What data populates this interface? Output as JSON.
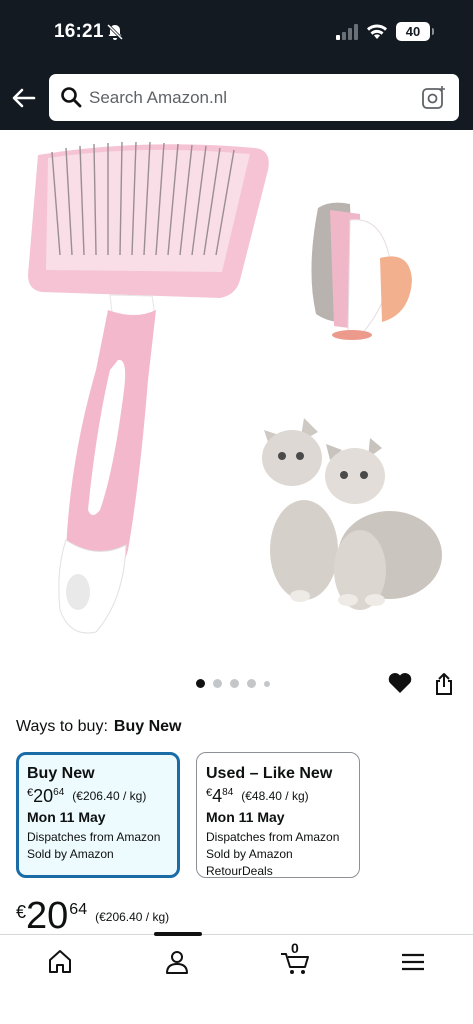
{
  "status_bar": {
    "time": "16:21",
    "battery": "40"
  },
  "search": {
    "placeholder": "Search Amazon.nl"
  },
  "gallery": {
    "dot_count": 5,
    "active_dot": 0
  },
  "ways_to_buy": {
    "label": "Ways to buy:",
    "selected": "Buy New"
  },
  "offers": [
    {
      "title": "Buy New",
      "currency": "€",
      "whole": "20",
      "cents": "64",
      "unit_price": "(€206.40 / kg)",
      "delivery_date": "Mon 11 May",
      "dispatch": "Dispatches from Amazon",
      "seller": "Sold by Amazon"
    },
    {
      "title": "Used – Like New",
      "currency": "€",
      "whole": "4",
      "cents": "84",
      "unit_price": "(€48.40 / kg)",
      "delivery_date": "Mon 11 May",
      "dispatch": "Dispatches from Amazon",
      "seller": "Sold by Amazon RetourDeals"
    }
  ],
  "price": {
    "currency": "€",
    "whole": "20",
    "cents": "64",
    "unit_price": "(€206.40 / kg)"
  },
  "bottom_nav": {
    "cart_count": "0",
    "items": [
      "home-icon",
      "account-icon",
      "cart-icon",
      "menu-icon"
    ]
  },
  "colors": {
    "header_bg": "#131a22",
    "selected_border": "#1a6ca7",
    "selected_bg": "#edfafe",
    "brush_pink": "#f3b8cb"
  }
}
